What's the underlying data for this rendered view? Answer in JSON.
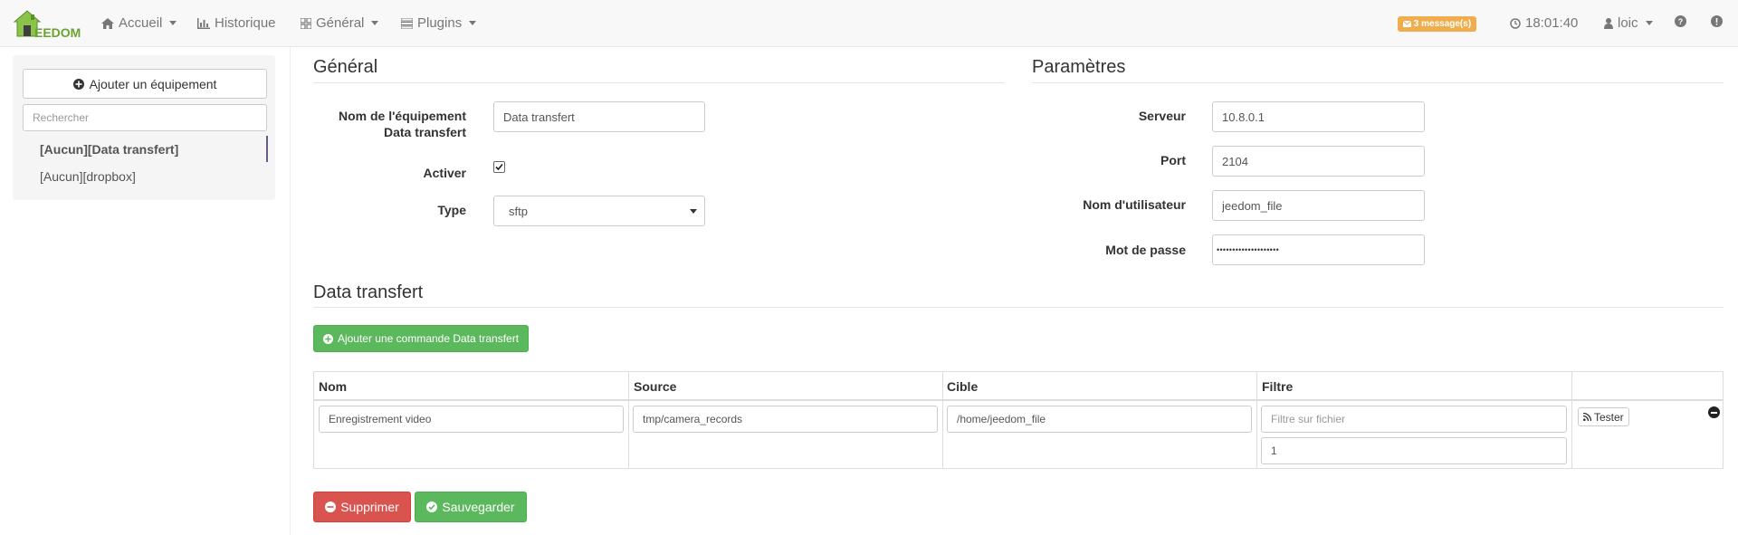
{
  "navbar": {
    "logo_text": "EEDOM",
    "items": [
      {
        "label": "Accueil",
        "icon": "home-icon"
      },
      {
        "label": "Historique",
        "icon": "bar-chart-icon"
      },
      {
        "label": "Général",
        "icon": "grid-icon"
      },
      {
        "label": "Plugins",
        "icon": "tasks-icon"
      }
    ],
    "messages_badge": "3 message(s)",
    "time": "18:01:40",
    "user": "loic",
    "accent_color": "#f0ad4e",
    "brand_color": "#6aa32f"
  },
  "sidebar": {
    "add_button_label": "Ajouter un équipement",
    "search_placeholder": "Rechercher",
    "equipments": [
      {
        "label": "[Aucun][Data transfert]",
        "active": true
      },
      {
        "label": "[Aucun][dropbox]",
        "active": false
      }
    ]
  },
  "general": {
    "title": "Général",
    "name_label_line1": "Nom de l'équipement",
    "name_label_line2": "Data transfert",
    "name_value": "Data transfert",
    "activate_label": "Activer",
    "activate_checked": true,
    "type_label": "Type",
    "type_value": "sftp"
  },
  "params": {
    "title": "Paramètres",
    "server_label": "Serveur",
    "server_value": "10.8.0.1",
    "port_label": "Port",
    "port_value": "2104",
    "user_label": "Nom d'utilisateur",
    "user_value": "jeedom_file",
    "password_label": "Mot de passe",
    "password_value": "••••••••••••••••••••"
  },
  "transfer": {
    "title": "Data transfert",
    "add_command_label": "Ajouter une commande Data transfert",
    "columns": [
      "Nom",
      "Source",
      "Cible",
      "Filtre"
    ],
    "row": {
      "name": "Enregistrement video",
      "source": "tmp/camera_records",
      "target": "/home/jeedom_file",
      "filter_placeholder": "Filtre sur fichier",
      "filter_value": "1",
      "test_label": "Tester"
    }
  },
  "actions": {
    "delete_label": "Supprimer",
    "save_label": "Sauvegarder"
  }
}
